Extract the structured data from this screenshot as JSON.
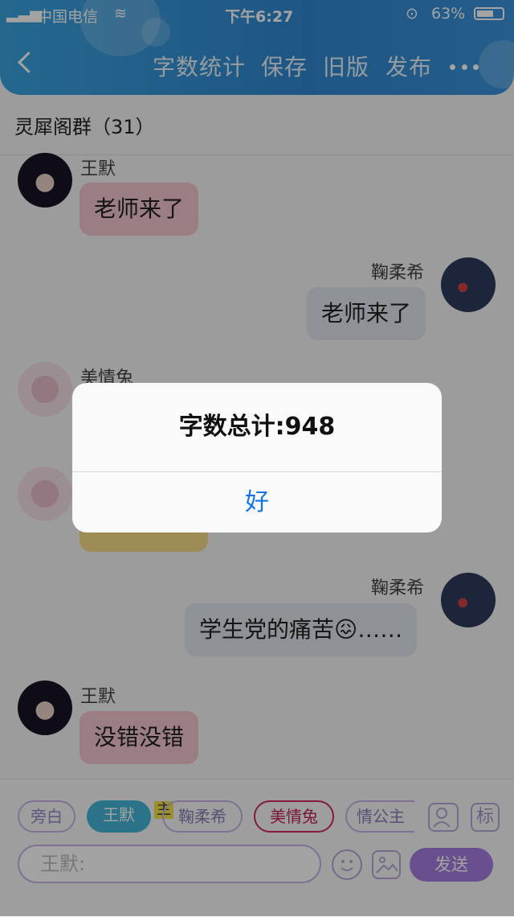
{
  "status_bar": {
    "carrier": "中国电信",
    "time": "下午6:27",
    "battery": "63%"
  },
  "toolbar": {
    "items": [
      "字数统计",
      "保存",
      "旧版",
      "发布"
    ],
    "back_icon": "chevron-left-icon",
    "more_icon": "ellipsis-icon"
  },
  "chat": {
    "title": "灵犀阁群（31）",
    "messages": [
      {
        "sender": "王默",
        "text": "老师来了"
      },
      {
        "sender": "鞠柔希",
        "text": "老师来了"
      },
      {
        "sender": "美情兔",
        "text": ""
      },
      {
        "sender": "",
        "text": ""
      },
      {
        "sender": "鞠柔希",
        "text": "学生党的痛苦😖……"
      },
      {
        "sender": "王默",
        "text": "没错没错"
      }
    ]
  },
  "roles": {
    "items": [
      "旁白",
      "王默",
      "鞠柔希",
      "美情兔",
      "情公主"
    ],
    "owner_badge": "主",
    "extra_label": "标"
  },
  "input": {
    "placeholder": "王默:",
    "send_label": "发送"
  },
  "dialog": {
    "message": "字数总计:948",
    "ok_label": "好"
  },
  "colors": {
    "header": "#2f86cf",
    "accent": "#a77ce0",
    "dialog_button": "#1476e6"
  }
}
